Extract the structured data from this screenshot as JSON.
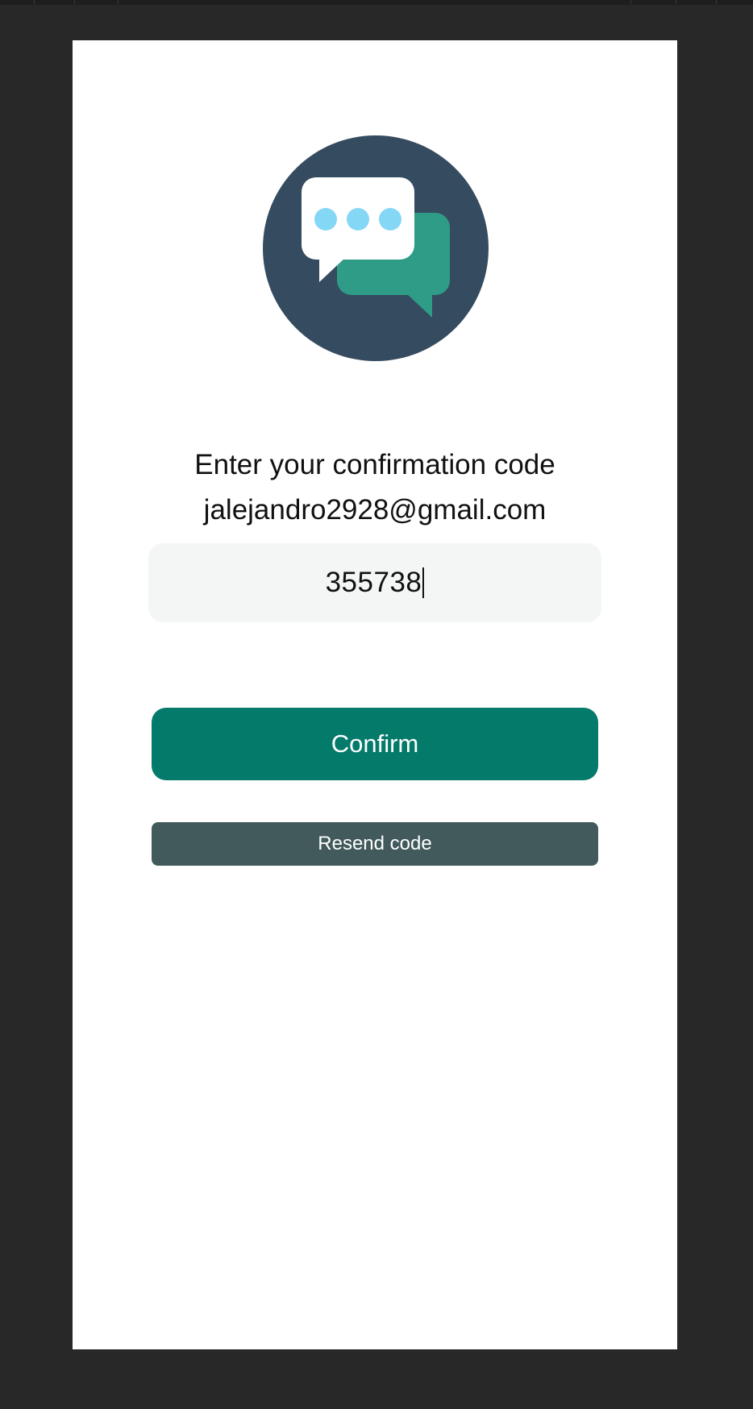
{
  "confirmation": {
    "heading": "Enter your confirmation code",
    "email": "jalejandro2928@gmail.com",
    "code_value": "355738",
    "confirm_label": "Confirm",
    "resend_label": "Resend code"
  },
  "logo": {
    "icon": "chat-bubbles-icon"
  },
  "colors": {
    "background": "#282828",
    "card": "#ffffff",
    "logo_circle": "#354b60",
    "logo_bubble_front": "#ffffff",
    "logo_bubble_back": "#2e9c86",
    "logo_dots": "#85d7f6",
    "input_bg": "#f3f6f5",
    "confirm_button": "#047a6b",
    "resend_button": "#425a5c",
    "text": "#111111"
  }
}
